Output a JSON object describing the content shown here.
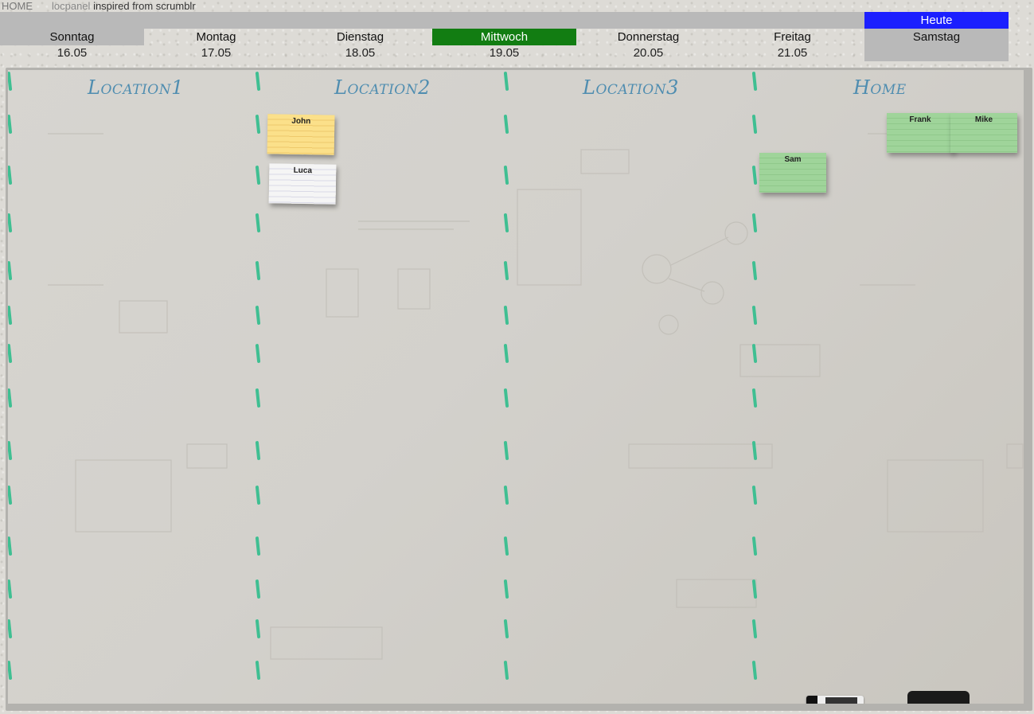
{
  "header": {
    "home_label": "HOME",
    "tagline_brand": "locpanel",
    "tagline_rest": "inspired from scrumblr"
  },
  "days": [
    {
      "name": "Sonntag",
      "date": "16.05"
    },
    {
      "name": "Montag",
      "date": "17.05"
    },
    {
      "name": "Dienstag",
      "date": "18.05"
    },
    {
      "name": "Mittwoch",
      "date": "19.05",
      "current": true
    },
    {
      "name": "Donnerstag",
      "date": "20.05"
    },
    {
      "name": "Freitag",
      "date": "21.05"
    },
    {
      "name": "Samstag",
      "date": ""
    }
  ],
  "today_badge": "Heute",
  "colors": {
    "today_badge": "#1b1fff",
    "current_day": "#127d12",
    "location_title": "#4f8db0",
    "divider": "#3fbf92"
  },
  "locations": [
    {
      "title": "Location1"
    },
    {
      "title": "Location2"
    },
    {
      "title": "Location3"
    },
    {
      "title": "Home"
    }
  ],
  "cards": [
    {
      "name": "John",
      "color": "yellow",
      "location": "Location2"
    },
    {
      "name": "Luca",
      "color": "white",
      "location": "Location2"
    },
    {
      "name": "Sam",
      "color": "green",
      "location": "Home"
    },
    {
      "name": "Frank",
      "color": "green",
      "location": "Home"
    },
    {
      "name": "Mike",
      "color": "green",
      "location": "Home"
    }
  ]
}
